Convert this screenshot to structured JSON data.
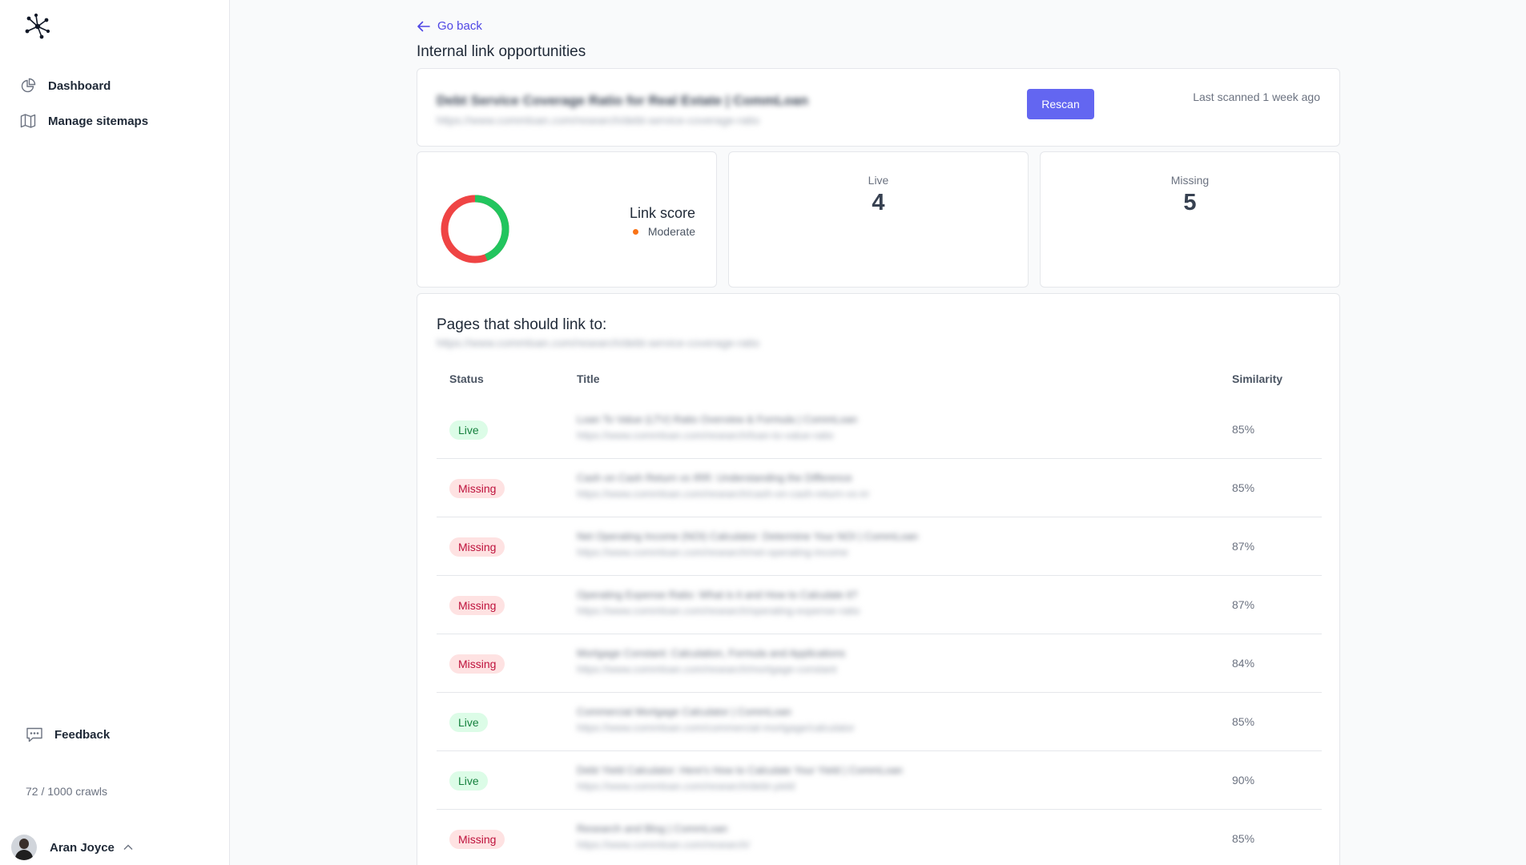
{
  "sidebar": {
    "logo": "network-logo-icon",
    "items": [
      {
        "label": "Dashboard",
        "icon": "pie-chart-icon"
      },
      {
        "label": "Manage sitemaps",
        "icon": "map-icon"
      }
    ],
    "feedback": {
      "label": "Feedback",
      "icon": "chat-bubble-icon"
    },
    "crawls": "72 / 1000 crawls",
    "user": {
      "name": "Aran Joyce",
      "icon": "chevron-up-icon"
    }
  },
  "main": {
    "go_back": "Go back",
    "title": "Internal link opportunities",
    "page": {
      "title": "Debt Service Coverage Ratio for Real Estate | CommLoan",
      "url": "https://www.commloan.com/research/debt-service-coverage-ratio"
    },
    "rescan": "Rescan",
    "last_scanned": "Last scanned 1 week ago",
    "score": {
      "label": "Link score",
      "status": "Moderate",
      "live_fraction": 0.44,
      "colors": {
        "live": "#22c55e",
        "missing": "#ef4444",
        "status_dot": "#f97316"
      }
    },
    "stats": {
      "live_label": "Live",
      "live_value": "4",
      "missing_label": "Missing",
      "missing_value": "5"
    },
    "table": {
      "title": "Pages that should link to:",
      "url": "https://www.commloan.com/research/debt-service-coverage-ratio",
      "headers": {
        "status": "Status",
        "title": "Title",
        "similarity": "Similarity"
      },
      "rows": [
        {
          "status": "Live",
          "title": "Loan To Value (LTV) Ratio Overview & Formula | CommLoan",
          "url": "https://www.commloan.com/research/loan-to-value-ratio",
          "similarity": "85%"
        },
        {
          "status": "Missing",
          "title": "Cash on Cash Return vs IRR: Understanding the Difference",
          "url": "https://www.commloan.com/research/cash-on-cash-return-vs-irr",
          "similarity": "85%"
        },
        {
          "status": "Missing",
          "title": "Net Operating Income (NOI) Calculator: Determine Your NOI | CommLoan",
          "url": "https://www.commloan.com/research/net-operating-income",
          "similarity": "87%"
        },
        {
          "status": "Missing",
          "title": "Operating Expense Ratio: What is it and How to Calculate it?",
          "url": "https://www.commloan.com/research/operating-expense-ratio",
          "similarity": "87%"
        },
        {
          "status": "Missing",
          "title": "Mortgage Constant: Calculation, Formula and Applications",
          "url": "https://www.commloan.com/research/mortgage-constant",
          "similarity": "84%"
        },
        {
          "status": "Live",
          "title": "Commercial Mortgage Calculator | CommLoan",
          "url": "https://www.commloan.com/commercial-mortgage/calculator",
          "similarity": "85%"
        },
        {
          "status": "Live",
          "title": "Debt Yield Calculator: Here's How to Calculate Your Yield | CommLoan",
          "url": "https://www.commloan.com/research/debt-yield",
          "similarity": "90%"
        },
        {
          "status": "Missing",
          "title": "Research and Blog | CommLoan",
          "url": "https://www.commloan.com/research/",
          "similarity": "85%"
        }
      ]
    }
  }
}
